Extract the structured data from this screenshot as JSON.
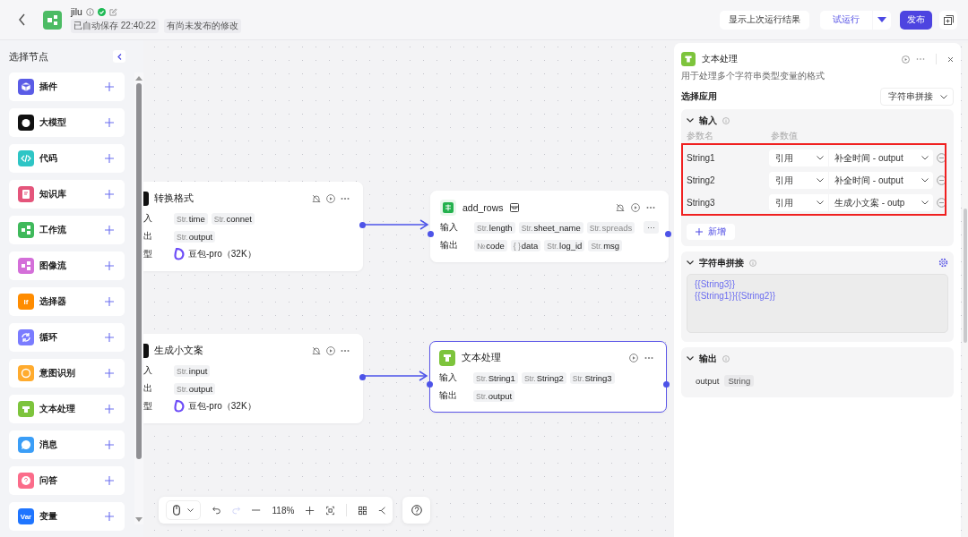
{
  "header": {
    "title": "jilu",
    "autosave": "已自动保存 22:40:22",
    "status": "有尚未发布的修改"
  },
  "actions": {
    "last_run": "显示上次运行结果",
    "test_run": "试运行",
    "publish": "发布"
  },
  "sidebar": {
    "title": "选择节点",
    "items": [
      {
        "label": "插件",
        "kind": "plugin"
      },
      {
        "label": "大模型",
        "kind": "llm"
      },
      {
        "label": "代码",
        "kind": "code"
      },
      {
        "label": "知识库",
        "kind": "knowledge"
      },
      {
        "label": "工作流",
        "kind": "workflow"
      },
      {
        "label": "图像流",
        "kind": "imageflow"
      },
      {
        "label": "选择器",
        "kind": "selector",
        "icon_text": "If"
      },
      {
        "label": "循环",
        "kind": "loop"
      },
      {
        "label": "意图识别",
        "kind": "intent"
      },
      {
        "label": "文本处理",
        "kind": "text"
      },
      {
        "label": "消息",
        "kind": "message"
      },
      {
        "label": "问答",
        "kind": "qa"
      },
      {
        "label": "变量",
        "kind": "variable",
        "icon_text": "Var"
      }
    ]
  },
  "nodes": [
    {
      "kind": "llm",
      "title": "转换格式",
      "selected": false,
      "rows": [
        {
          "label": "入",
          "tags": [
            {
              "type": "Str.",
              "name": "time"
            },
            {
              "type": "Str.",
              "name": "connet"
            }
          ]
        },
        {
          "label": "出",
          "tags": [
            {
              "type": "Str.",
              "name": "output"
            }
          ]
        },
        {
          "label": "型",
          "model": "豆包-pro（32K）"
        }
      ]
    },
    {
      "kind": "plugin",
      "title": "add_rows",
      "selected": false,
      "rows": [
        {
          "label": "输入",
          "tags": [
            {
              "type": "Str.",
              "name": "length"
            },
            {
              "type": "Str.",
              "name": "sheet_name"
            },
            {
              "type": "Str.",
              "name": "spreads",
              "faded": true
            }
          ],
          "more": "···"
        },
        {
          "label": "输出",
          "tags": [
            {
              "type": "№",
              "name": "code"
            },
            {
              "type": "{ }",
              "name": "data"
            },
            {
              "type": "Str.",
              "name": "log_id"
            },
            {
              "type": "Str.",
              "name": "msg"
            }
          ]
        }
      ]
    },
    {
      "kind": "llm",
      "title": "生成小文案",
      "selected": false,
      "rows": [
        {
          "label": "入",
          "tags": [
            {
              "type": "Str.",
              "name": "input"
            }
          ]
        },
        {
          "label": "出",
          "tags": [
            {
              "type": "Str.",
              "name": "output"
            }
          ]
        },
        {
          "label": "型",
          "model": "豆包-pro（32K）"
        }
      ]
    },
    {
      "kind": "text",
      "title": "文本处理",
      "selected": true,
      "rows": [
        {
          "label": "输入",
          "tags": [
            {
              "type": "Str.",
              "name": "String1"
            },
            {
              "type": "Str.",
              "name": "String2"
            },
            {
              "type": "Str.",
              "name": "String3"
            }
          ]
        },
        {
          "label": "输出",
          "tags": [
            {
              "type": "Str.",
              "name": "output"
            }
          ]
        }
      ]
    }
  ],
  "toolbar": {
    "zoom": "118%"
  },
  "panel": {
    "title": "文本处理",
    "description": "用于处理多个字符串类型变量的格式",
    "app_label": "选择应用",
    "app_value": "字符串拼接",
    "input": {
      "title": "输入",
      "expanded": true,
      "col_name": "参数名",
      "col_value": "参数值",
      "add": "新增",
      "params": [
        {
          "name": "String1",
          "source": "引用",
          "value": "补全时间 - output"
        },
        {
          "name": "String2",
          "source": "引用",
          "value": "补全时间 - output"
        },
        {
          "name": "String3",
          "source": "引用",
          "value": "生成小文案 - outp"
        }
      ]
    },
    "template": {
      "title": "字符串拼接",
      "expanded": true,
      "lines": [
        "{{String3}}",
        "{{String1}}{{String2}}"
      ]
    },
    "output": {
      "title": "输出",
      "expanded": true,
      "name": "output",
      "type": "String"
    }
  }
}
